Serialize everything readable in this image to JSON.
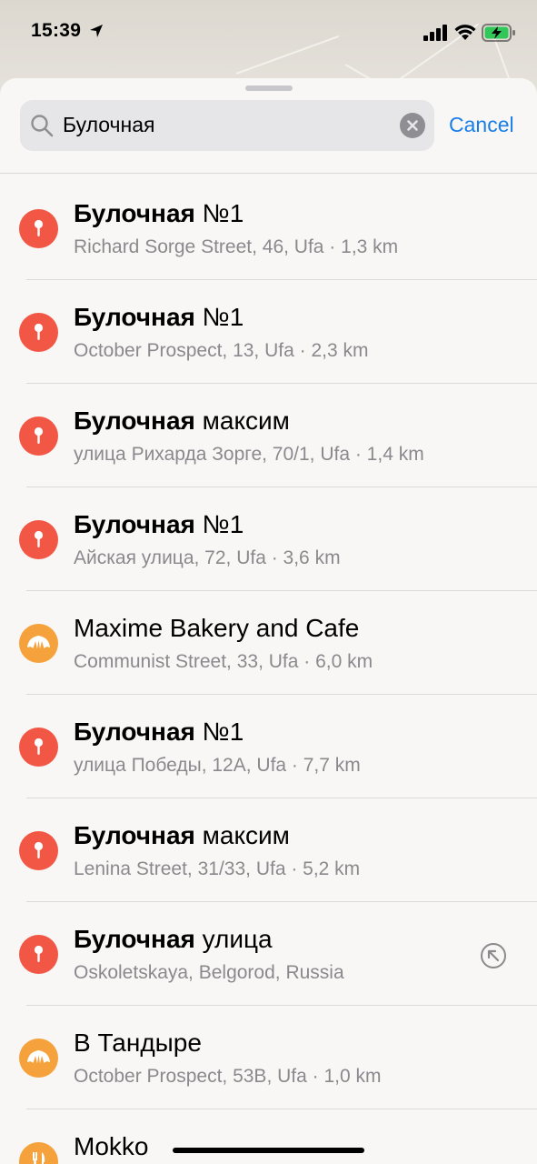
{
  "status_bar": {
    "time": "15:39"
  },
  "colors": {
    "accent": "#1a7ee8",
    "pin": "#f25746",
    "bakery": "#f6a23c",
    "subtitle": "#8a8a8e"
  },
  "search": {
    "query": "Булочная",
    "cancel_label": "Cancel"
  },
  "results": [
    {
      "title_bold": "Булочная",
      "title_rest": " №1",
      "subtitle": "Richard Sorge Street, 46, Ufa · 1,3 km",
      "icon": "pin-icon"
    },
    {
      "title_bold": "Булочная",
      "title_rest": " №1",
      "subtitle": "October Prospect, 13, Ufa · 2,3 km",
      "icon": "pin-icon"
    },
    {
      "title_bold": "Булочная",
      "title_rest": " максим",
      "subtitle": "улица Рихарда Зорге, 70/1, Ufa · 1,4 km",
      "icon": "pin-icon"
    },
    {
      "title_bold": "Булочная",
      "title_rest": " №1",
      "subtitle": "Айская улица, 72, Ufa · 3,6 km",
      "icon": "pin-icon"
    },
    {
      "title_bold": "",
      "title_rest": "Maxime Bakery and Cafe",
      "subtitle": "Communist Street, 33, Ufa · 6,0 km",
      "icon": "croissant-icon"
    },
    {
      "title_bold": "Булочная",
      "title_rest": " №1",
      "subtitle": "улица Победы, 12А, Ufa · 7,7 km",
      "icon": "pin-icon"
    },
    {
      "title_bold": "Булочная",
      "title_rest": " максим",
      "subtitle": "Lenina Street, 31/33, Ufa · 5,2 km",
      "icon": "pin-icon"
    },
    {
      "title_bold": "Булочная",
      "title_rest": " улица",
      "subtitle": "Oskoletskaya, Belgorod, Russia",
      "icon": "pin-icon",
      "action_icon": "fill-query-arrow-icon"
    },
    {
      "title_bold": "",
      "title_rest": "В Тандыре",
      "subtitle": "October Prospect, 53В, Ufa · 1,0 km",
      "icon": "croissant-icon"
    },
    {
      "title_bold": "",
      "title_rest": "Mokko",
      "subtitle": "",
      "icon": "fork-knife-icon"
    }
  ]
}
